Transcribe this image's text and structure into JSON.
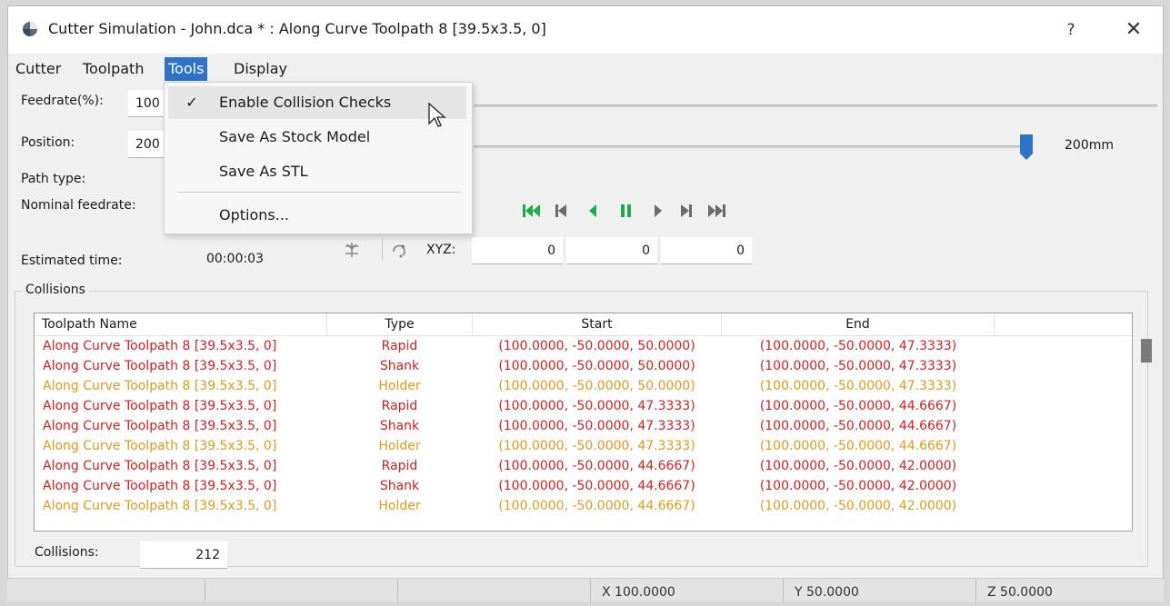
{
  "window": {
    "title": "Cutter Simulation - John.dca * : Along Curve Toolpath 8 [39.5x3.5, 0]",
    "help_label": "?",
    "close_label": "✕"
  },
  "menubar": {
    "items": [
      {
        "label": "Cutter"
      },
      {
        "label": "Toolpath"
      },
      {
        "label": "Tools"
      },
      {
        "label": "Display"
      }
    ],
    "active": "Tools"
  },
  "tools_menu": {
    "items": [
      {
        "label": "Enable Collision Checks",
        "checked": true
      },
      {
        "label": "Save As Stock Model",
        "checked": false
      },
      {
        "label": "Save As STL",
        "checked": false
      },
      {
        "label": "Options...",
        "checked": false
      }
    ],
    "check_glyph": "✓"
  },
  "controls": {
    "feedrate_label": "Feedrate(%):",
    "feedrate_value": "100",
    "position_label": "Position:",
    "position_value": "200",
    "position_fraction": 1.0,
    "position_readout": "200mm",
    "path_type_label": "Path type:",
    "nominal_feedrate_label": "Nominal feedrate:",
    "estimated_time_label": "Estimated time:",
    "estimated_time_value": "00:00:03",
    "xyz_label": "XYZ:",
    "x_value": "0",
    "y_value": "0",
    "z_value": "0"
  },
  "transport_icons": [
    "skip-to-start-icon",
    "step-back-icon",
    "play-reverse-icon",
    "pause-icon",
    "play-icon",
    "step-forward-icon",
    "skip-to-end-icon"
  ],
  "collisions": {
    "group_title": "Collisions",
    "columns": [
      "Toolpath Name",
      "Type",
      "Start",
      "End"
    ],
    "rows": [
      {
        "name": "Along Curve Toolpath 8 [39.5x3.5, 0]",
        "type": "Rapid",
        "start": "(100.0000, -50.0000, 50.0000)",
        "end": "(100.0000, -50.0000, 47.3333)"
      },
      {
        "name": "Along Curve Toolpath 8 [39.5x3.5, 0]",
        "type": "Shank",
        "start": "(100.0000, -50.0000, 50.0000)",
        "end": "(100.0000, -50.0000, 47.3333)"
      },
      {
        "name": "Along Curve Toolpath 8 [39.5x3.5, 0]",
        "type": "Holder",
        "start": "(100.0000, -50.0000, 50.0000)",
        "end": "(100.0000, -50.0000, 47.3333)"
      },
      {
        "name": "Along Curve Toolpath 8 [39.5x3.5, 0]",
        "type": "Rapid",
        "start": "(100.0000, -50.0000, 47.3333)",
        "end": "(100.0000, -50.0000, 44.6667)"
      },
      {
        "name": "Along Curve Toolpath 8 [39.5x3.5, 0]",
        "type": "Shank",
        "start": "(100.0000, -50.0000, 47.3333)",
        "end": "(100.0000, -50.0000, 44.6667)"
      },
      {
        "name": "Along Curve Toolpath 8 [39.5x3.5, 0]",
        "type": "Holder",
        "start": "(100.0000, -50.0000, 47.3333)",
        "end": "(100.0000, -50.0000, 44.6667)"
      },
      {
        "name": "Along Curve Toolpath 8 [39.5x3.5, 0]",
        "type": "Rapid",
        "start": "(100.0000, -50.0000, 44.6667)",
        "end": "(100.0000, -50.0000, 42.0000)"
      },
      {
        "name": "Along Curve Toolpath 8 [39.5x3.5, 0]",
        "type": "Shank",
        "start": "(100.0000, -50.0000, 44.6667)",
        "end": "(100.0000, -50.0000, 42.0000)"
      },
      {
        "name": "Along Curve Toolpath 8 [39.5x3.5, 0]",
        "type": "Holder",
        "start": "(100.0000, -50.0000, 44.6667)",
        "end": "(100.0000, -50.0000, 42.0000)"
      }
    ],
    "count_label": "Collisions:",
    "count_value": "212"
  },
  "colors": {
    "red_row": "#d42020",
    "holder_row": "#e09a1e",
    "menu_active": "#2f72c9",
    "transport_green": "#1faa4a",
    "transport_gray": "#6b6b6b",
    "slider_thumb": "#2f72c9"
  },
  "statusbar": {
    "x": "X  100.0000",
    "y": "Y  50.0000",
    "z": "Z  50.0000"
  }
}
